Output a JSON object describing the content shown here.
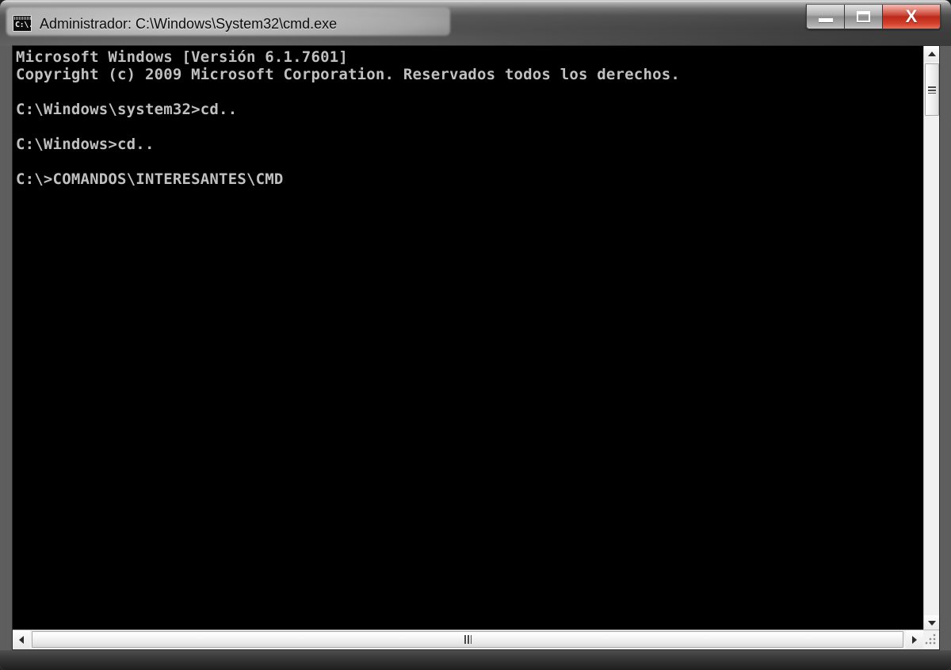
{
  "window": {
    "title": "Administrador: C:\\Windows\\System32\\cmd.exe",
    "icon_name": "cmd-icon",
    "icon_text": "C:\\.",
    "colors": {
      "console_background": "#000000",
      "console_text": "#c0c0c0",
      "titlebar_dark": "#3e3e3e",
      "titlebar_glass": "#cdcdcd",
      "close_button": "#bb2a1a",
      "scrollbar_track": "#f1f1f1"
    }
  },
  "controls": {
    "minimize_label": "–",
    "maximize_label": "□",
    "close_label": "X",
    "minimize_name": "minimize-button",
    "maximize_name": "maximize-button",
    "close_name": "close-button"
  },
  "console": {
    "lines": [
      "Microsoft Windows [Versión 6.1.7601]",
      "Copyright (c) 2009 Microsoft Corporation. Reservados todos los derechos.",
      "",
      "C:\\Windows\\system32>cd..",
      "",
      "C:\\Windows>cd..",
      "",
      "C:\\>COMANDOS\\INTERESANTES\\CMD"
    ]
  },
  "scrollbars": {
    "vertical": {
      "up_arrow": "scroll-up-arrow",
      "down_arrow": "scroll-down-arrow",
      "thumb": "vertical-scroll-thumb"
    },
    "horizontal": {
      "left_arrow": "scroll-left-arrow",
      "right_arrow": "scroll-right-arrow",
      "thumb": "horizontal-scroll-thumb"
    }
  }
}
